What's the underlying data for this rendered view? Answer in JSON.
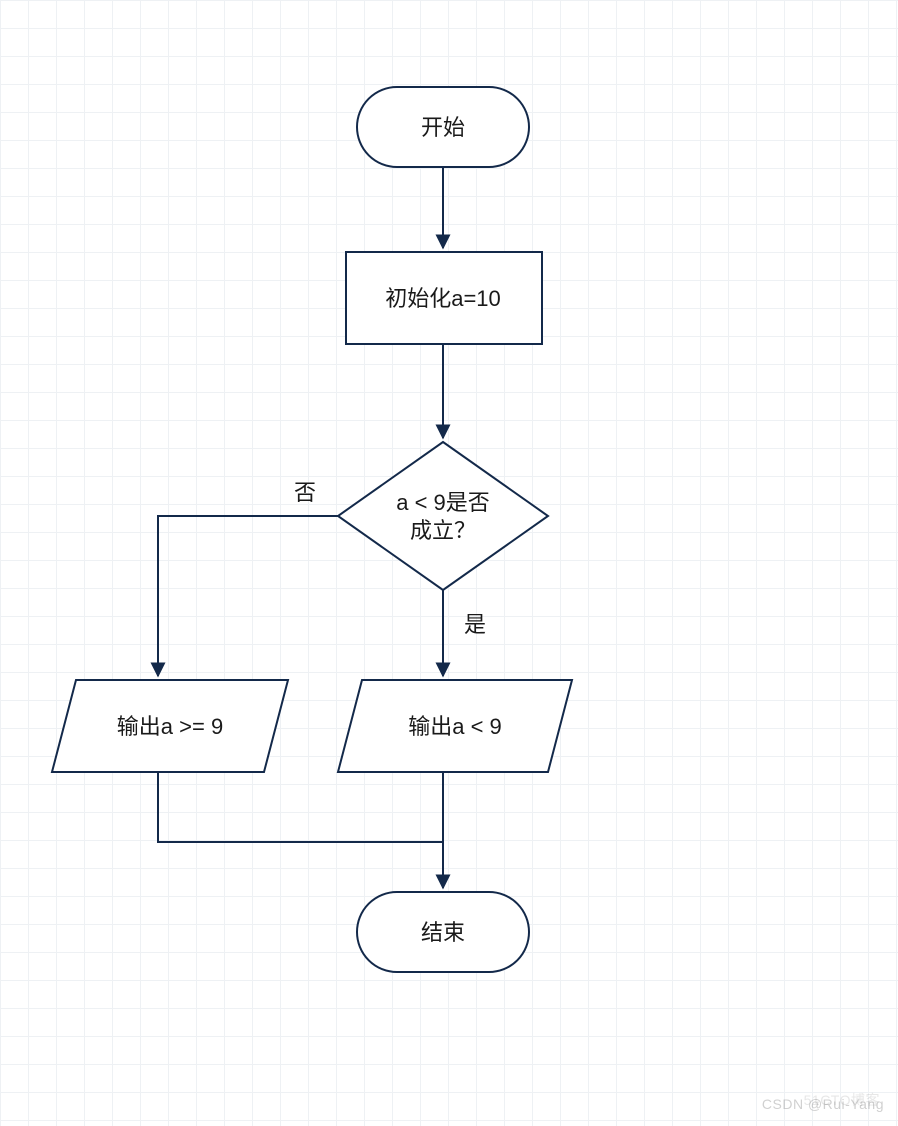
{
  "flow": {
    "start": {
      "label": "开始"
    },
    "init": {
      "label": "初始化a=10"
    },
    "decision": {
      "line1": "a < 9是否",
      "line2": "成立？"
    },
    "edge_no": "否",
    "edge_yes": "是",
    "out_left": {
      "label": "输出a >= 9"
    },
    "out_right": {
      "label": "输出a < 9"
    },
    "end": {
      "label": "结束"
    }
  },
  "watermark": {
    "primary": "CSDN @Rui-Yang",
    "secondary": "51CTO博客"
  }
}
